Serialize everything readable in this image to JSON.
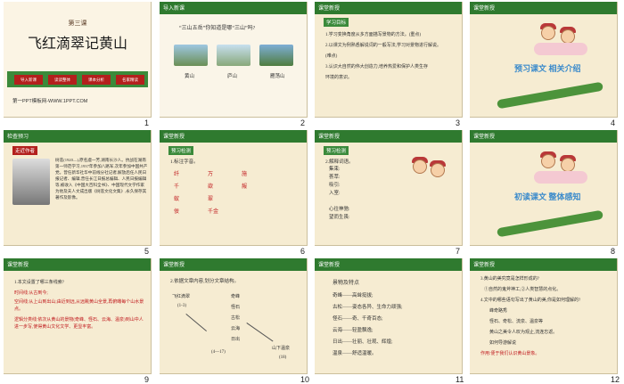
{
  "slides": [
    {
      "num": "1",
      "lesson": "第三课",
      "title": "飞红滴翠记黄山",
      "pills": [
        "导入新课",
        "读读整体",
        "课本分析",
        "名家精读"
      ],
      "footer": "第一PPT模板网-WWW.1PPT.COM"
    },
    {
      "num": "2",
      "tag": "导入新课",
      "question": "“三山五岳”你知道是哪“三山”吗?",
      "photos": [
        "黄山",
        "庐山",
        "雁荡山"
      ]
    },
    {
      "num": "3",
      "tag": "课堂新授",
      "box": "学习目标",
      "goals": [
        "1.学习变换角度从多方面描写景物的方法。(重点)",
        "2.以课文为例熟悉解说词的一般写法,学习对景物进行解说。",
        "(难点)",
        "3.认识大自然的伟大创造力,培养热爱和保护人类生存",
        "环境的意识。"
      ]
    },
    {
      "num": "4",
      "tag": "课堂新授",
      "banner": "预习课文  相关介绍"
    },
    {
      "num": "5",
      "tag": "检查预习",
      "box": "走近作者",
      "bio": "树莲(1920—),原名虞一芳,湖南长沙人。抗战在湖南第一师范学习,1937年参加八路军,次年参加中国共产党。曾任新华社华中前线分社记者,解放后任人民日报记者、编辑,曾任长江日报总编辑、人民日报编辑等,被收入《中国大百科全书》、中国现代文学作家为他及夫人文成出版《树莲文化文集》,永久保存其著作及影像。"
    },
    {
      "num": "6",
      "tag": "课堂新授",
      "box": "预习检测",
      "head": "1.标注字音。",
      "rows": [
        [
          "纤",
          "万",
          "施"
        ],
        [
          "千",
          "欲",
          "赧"
        ],
        [
          "蚁",
          "翠",
          ""
        ],
        [
          "佞",
          "千金",
          ""
        ]
      ]
    },
    {
      "num": "7",
      "tag": "课堂新授",
      "box": "预习检测",
      "head": "2.解释词语。",
      "terms": [
        "集束:",
        "荟萃:",
        "吸引:",
        "入室:",
        "",
        "心往神驰:",
        "望而生畏:"
      ]
    },
    {
      "num": "8",
      "tag": "课堂新授",
      "banner": "初读课文  整体感知"
    },
    {
      "num": "9",
      "tag": "课堂新授",
      "items": [
        "1.本文设置了哪三条线索?",
        "时间线:从古到今;",
        "空间线:从上山到出山;由近到远,从远眺黄山全景,再俯瞰每个山水景点。",
        "逻辑分类线:依次从黄山的景物(奇峰、怪石、云海、温泉)到山中人进一步写,使得黄山文化文学、更显丰富。"
      ]
    },
    {
      "num": "10",
      "tag": "课堂新授",
      "head": "2.依据文章内容,划分文章结构。",
      "nodes": [
        "飞红滴翠",
        "(1-3)",
        "奇峰",
        "怪石",
        "古松",
        "云海",
        "日出",
        "山下温泉",
        "(18)",
        "(4—17)"
      ]
    },
    {
      "num": "11",
      "tag": "课堂新授",
      "head": "景物及特点",
      "items": [
        "奇峰——高耸挺拔;",
        "古松——姿态各异、生命力顽强;",
        "怪石——奇、千奇百态;",
        "云海——轻盈飘逸;",
        "日出——壮丽、壮观、辉煌;",
        "温泉——舒适温暖。"
      ]
    },
    {
      "num": "12",
      "tag": "课堂新授",
      "items": [
        "3.黄山的美究竟是怎样形成的?",
        "①自然的鬼斧神工,②人类智慧的点化。",
        "4.文中的哪些语句写出了黄山的美,你是如何理解的?",
        "峰奇路秀",
        "怪石、奇松、流泉、温泉等",
        "黄山之美令人叹为观止,流连忘返。",
        "如何导游解说",
        "作用:便于我们认识黄山景象。"
      ]
    }
  ],
  "colors": {
    "bg": "#f6ecd2",
    "green": "#3b8a3b",
    "red": "#c0191d",
    "blue": "#3a8acb"
  }
}
